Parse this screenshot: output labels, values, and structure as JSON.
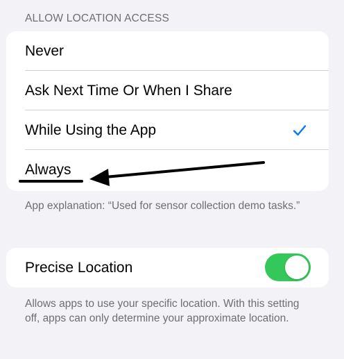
{
  "location_access": {
    "header": "ALLOW LOCATION ACCESS",
    "options": [
      {
        "label": "Never",
        "selected": false
      },
      {
        "label": "Ask Next Time Or When I Share",
        "selected": false
      },
      {
        "label": "While Using the App",
        "selected": true
      },
      {
        "label": "Always",
        "selected": false
      }
    ],
    "footer": "App explanation: “Used for sensor collection demo tasks.”"
  },
  "precise_location": {
    "label": "Precise Location",
    "enabled": true,
    "footer": "Allows apps to use your specific location. With this setting off, apps can only determine your approximate location."
  },
  "colors": {
    "accent": "#007aff",
    "toggle_on": "#34c759",
    "background": "#f2f2f7",
    "annotation": "#000000"
  },
  "icons": {
    "selected_marker": "checkmark-icon",
    "annotation_arrow": "arrow-left-icon"
  }
}
